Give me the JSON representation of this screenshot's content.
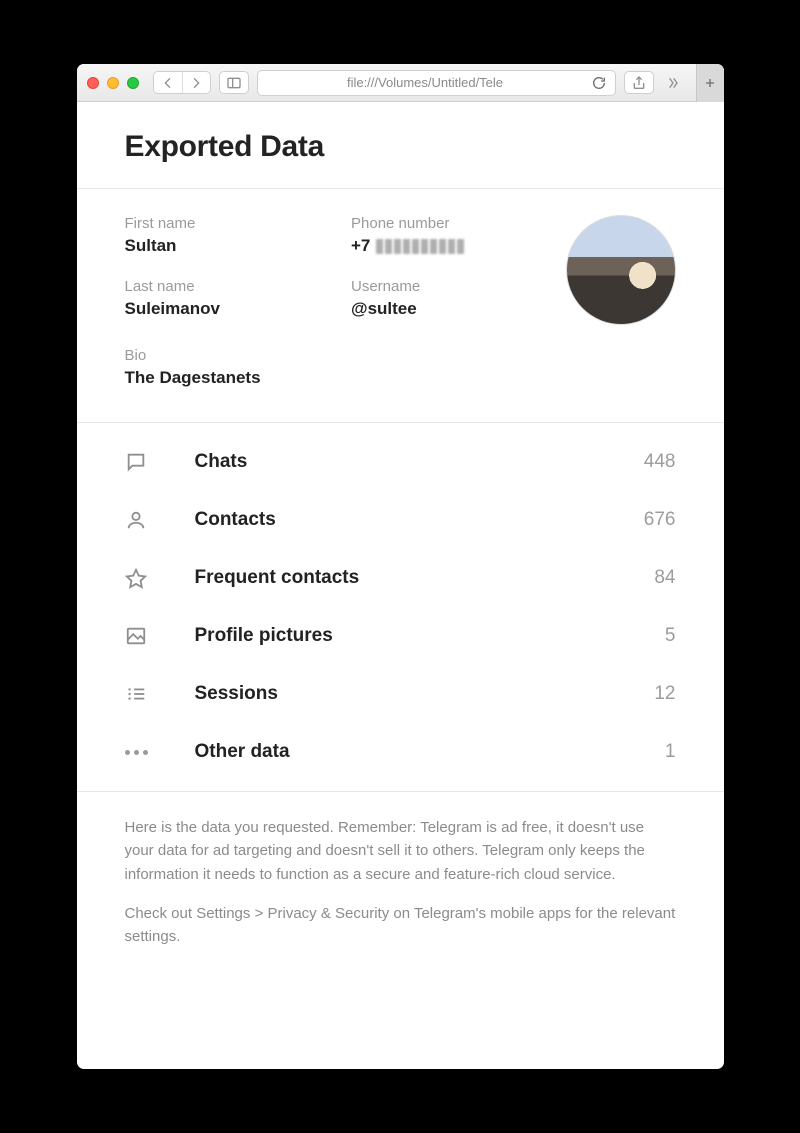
{
  "browser": {
    "address": "file:///Volumes/Untitled/Tele"
  },
  "page": {
    "title": "Exported Data"
  },
  "profile": {
    "first_name_label": "First name",
    "first_name": "Sultan",
    "last_name_label": "Last name",
    "last_name": "Suleimanov",
    "phone_label": "Phone number",
    "phone_prefix": "+7",
    "username_label": "Username",
    "username": "@sultee",
    "bio_label": "Bio",
    "bio": "The Dagestanets"
  },
  "sections": [
    {
      "id": "chats",
      "label": "Chats",
      "count": "448",
      "icon": "chat-icon"
    },
    {
      "id": "contacts",
      "label": "Contacts",
      "count": "676",
      "icon": "person-icon"
    },
    {
      "id": "frequent",
      "label": "Frequent contacts",
      "count": "84",
      "icon": "star-icon"
    },
    {
      "id": "pictures",
      "label": "Profile pictures",
      "count": "5",
      "icon": "image-icon"
    },
    {
      "id": "sessions",
      "label": "Sessions",
      "count": "12",
      "icon": "list-icon"
    },
    {
      "id": "other",
      "label": "Other data",
      "count": "1",
      "icon": "dots-icon"
    }
  ],
  "footer": {
    "p1": "Here is the data you requested. Remember: Telegram is ad free, it doesn't use your data for ad targeting and doesn't sell it to others. Telegram only keeps the information it needs to function as a secure and feature-rich cloud service.",
    "p2": "Check out Settings > Privacy & Security on Telegram's mobile apps for the relevant settings."
  }
}
